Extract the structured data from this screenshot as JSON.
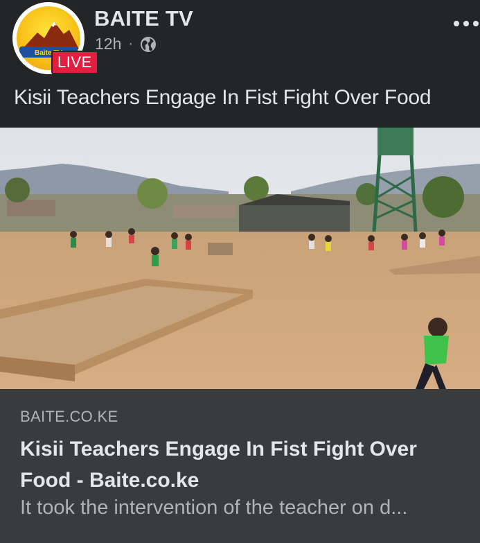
{
  "post": {
    "page_name": "BAITE TV",
    "time": "12h",
    "separator": "·",
    "audience_icon": "globe-icon",
    "live_label": "LIVE",
    "avatar_logo_text": "Baite TV",
    "more_icon": "more-horizontal-icon",
    "caption": "Kisii Teachers Engage In Fist Fight Over Food"
  },
  "link": {
    "domain": "BAITE.CO.KE",
    "title": "Kisii Teachers Engage In Fist Fight Over Food - Baite.co.ke",
    "description": "It took the intervention of the teacher on d..."
  },
  "colors": {
    "background": "#242526",
    "card": "#3a3b3c",
    "live_badge": "#e41e3f",
    "primary_text": "#e4e6eb",
    "secondary_text": "#b0b3b8"
  }
}
